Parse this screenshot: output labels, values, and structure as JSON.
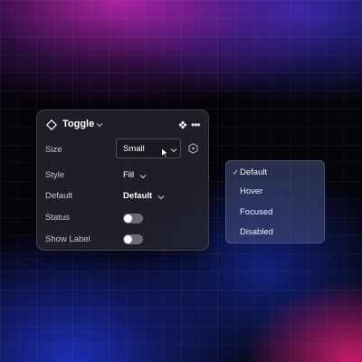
{
  "panel": {
    "title": "Toggle",
    "rows": {
      "size": {
        "label": "Size",
        "value": "Small"
      },
      "style": {
        "label": "Style",
        "value": "Fill"
      },
      "default": {
        "label": "Default",
        "value": "Default"
      },
      "status": {
        "label": "Status",
        "toggle_on": false
      },
      "show_label": {
        "label": "Show Label",
        "toggle_on": false
      }
    },
    "icons": {
      "header": "diamond-icon",
      "title_chevron": "chevron-down-icon",
      "component": "component-icon",
      "more": "more-horizontal-icon",
      "variable": "hexagon-icon"
    }
  },
  "dropdown": {
    "items": [
      {
        "label": "Default",
        "selected": true
      },
      {
        "label": "Hover",
        "selected": false
      },
      {
        "label": "Focused",
        "selected": false
      },
      {
        "label": "Disabled",
        "selected": false
      }
    ],
    "check_glyph": "✓"
  },
  "colors": {
    "panel_bg": "#26263099",
    "menu_bg": "#46508299",
    "toggle_off": "#6b6b74",
    "text_primary": "#ffffff",
    "text_secondary": "#c9c9d2"
  }
}
